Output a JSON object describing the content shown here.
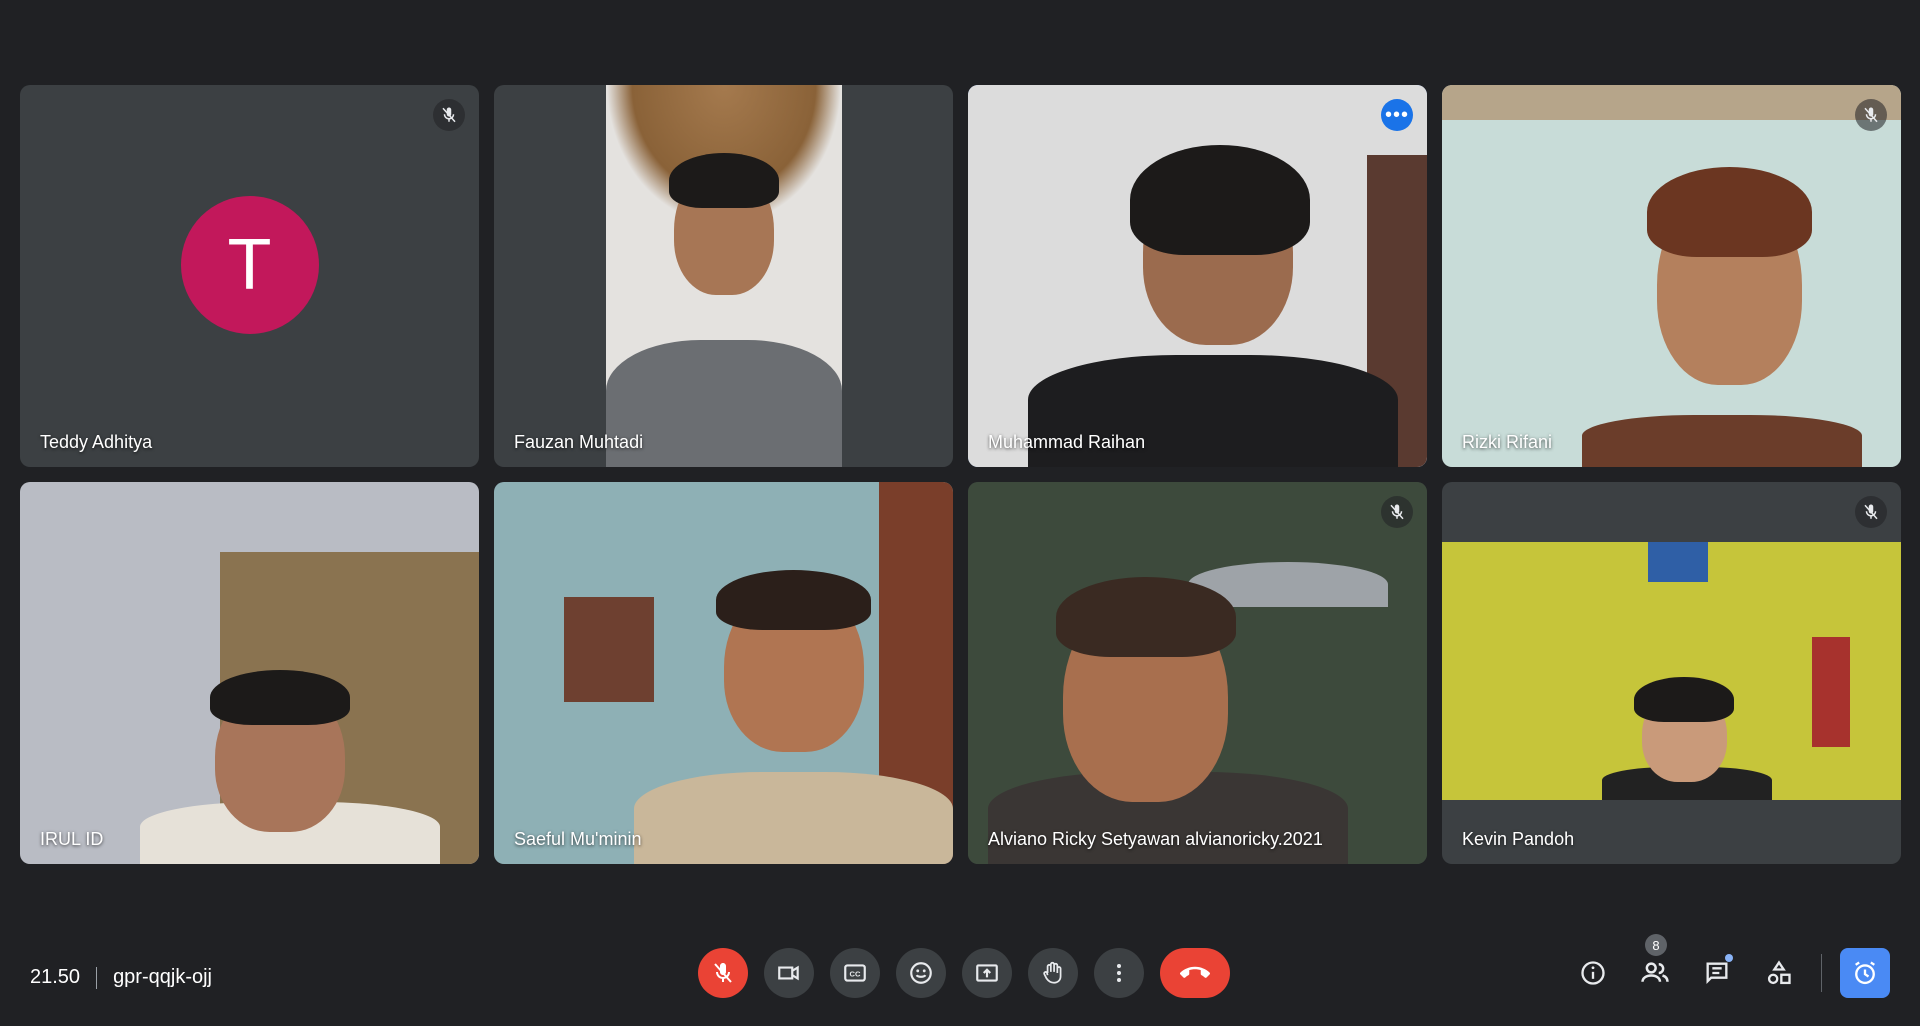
{
  "participants": [
    {
      "name": "Teddy Adhitya",
      "avatar_letter": "T",
      "muted": true,
      "video": false
    },
    {
      "name": "Fauzan Muhtadi",
      "muted": false,
      "video": true
    },
    {
      "name": "Muhammad Raihan",
      "muted": false,
      "video": true,
      "active_speaker": true
    },
    {
      "name": "Rizki Rifani",
      "muted": true,
      "video": true
    },
    {
      "name": "IRUL ID",
      "muted": false,
      "video": true
    },
    {
      "name": "Saeful Mu'minin",
      "muted": false,
      "video": true
    },
    {
      "name": "Alviano Ricky Setyawan alvianoricky.2021",
      "muted": true,
      "video": true
    },
    {
      "name": "Kevin Pandoh",
      "muted": true,
      "video": true
    }
  ],
  "meeting": {
    "time": "21.50",
    "code": "gpr-qqjk-ojj"
  },
  "controls": [
    "mic-off",
    "camera",
    "captions",
    "emoji",
    "present",
    "raise-hand",
    "more-options",
    "leave-call"
  ],
  "side": {
    "people_count": "8"
  },
  "colors": {
    "background": "#202124",
    "tile": "#3c4043",
    "accent": "#8ab4f8",
    "danger": "#ea4335",
    "avatar": "#c2185b"
  }
}
